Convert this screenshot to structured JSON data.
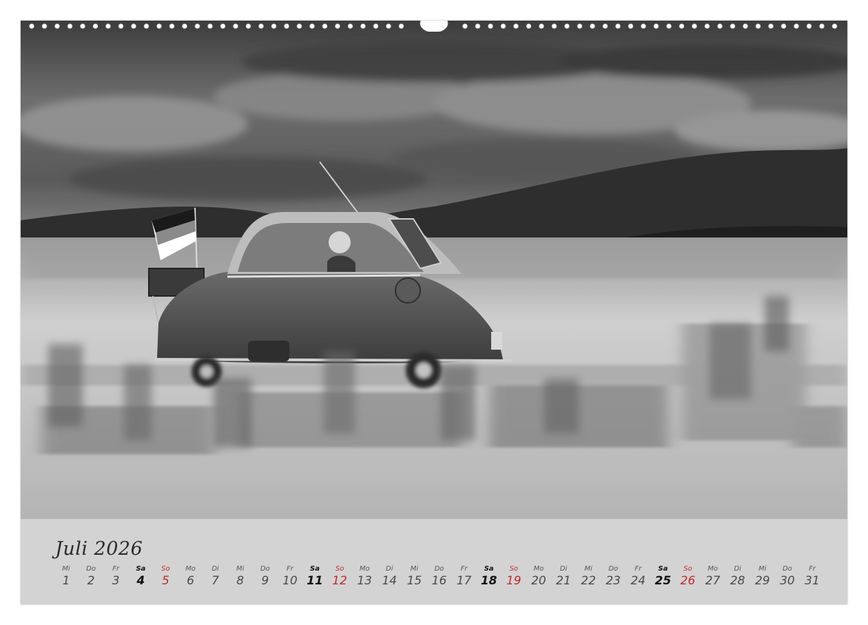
{
  "calendar": {
    "month_title": "Juli 2026",
    "colors": {
      "weekday": "#4a4a4a",
      "saturday": "#111111",
      "sunday": "#c62828",
      "panel": "#d3d3d3"
    },
    "days": [
      {
        "wd": "Mi",
        "num": "1",
        "type": "weekday"
      },
      {
        "wd": "Do",
        "num": "2",
        "type": "weekday"
      },
      {
        "wd": "Fr",
        "num": "3",
        "type": "weekday"
      },
      {
        "wd": "Sa",
        "num": "4",
        "type": "sat"
      },
      {
        "wd": "So",
        "num": "5",
        "type": "sun"
      },
      {
        "wd": "Mo",
        "num": "6",
        "type": "weekday"
      },
      {
        "wd": "Di",
        "num": "7",
        "type": "weekday"
      },
      {
        "wd": "Mi",
        "num": "8",
        "type": "weekday"
      },
      {
        "wd": "Do",
        "num": "9",
        "type": "weekday"
      },
      {
        "wd": "Fr",
        "num": "10",
        "type": "weekday"
      },
      {
        "wd": "Sa",
        "num": "11",
        "type": "sat"
      },
      {
        "wd": "So",
        "num": "12",
        "type": "sun"
      },
      {
        "wd": "Mo",
        "num": "13",
        "type": "weekday"
      },
      {
        "wd": "Di",
        "num": "14",
        "type": "weekday"
      },
      {
        "wd": "Mi",
        "num": "15",
        "type": "weekday"
      },
      {
        "wd": "Do",
        "num": "16",
        "type": "weekday"
      },
      {
        "wd": "Fr",
        "num": "17",
        "type": "weekday"
      },
      {
        "wd": "Sa",
        "num": "18",
        "type": "sat"
      },
      {
        "wd": "So",
        "num": "19",
        "type": "sun"
      },
      {
        "wd": "Mo",
        "num": "20",
        "type": "weekday"
      },
      {
        "wd": "Di",
        "num": "21",
        "type": "weekday"
      },
      {
        "wd": "Mi",
        "num": "22",
        "type": "weekday"
      },
      {
        "wd": "Do",
        "num": "23",
        "type": "weekday"
      },
      {
        "wd": "Fr",
        "num": "24",
        "type": "weekday"
      },
      {
        "wd": "Sa",
        "num": "25",
        "type": "sat"
      },
      {
        "wd": "So",
        "num": "26",
        "type": "sun"
      },
      {
        "wd": "Mo",
        "num": "27",
        "type": "weekday"
      },
      {
        "wd": "Di",
        "num": "28",
        "type": "weekday"
      },
      {
        "wd": "Mi",
        "num": "29",
        "type": "weekday"
      },
      {
        "wd": "Do",
        "num": "30",
        "type": "weekday"
      },
      {
        "wd": "Fr",
        "num": "31",
        "type": "weekday"
      }
    ]
  },
  "photo": {
    "subject": "bubble-car-icon",
    "flag_colors": [
      "#1a1a1a",
      "#8a8a8a",
      "#e8e8e8"
    ]
  }
}
